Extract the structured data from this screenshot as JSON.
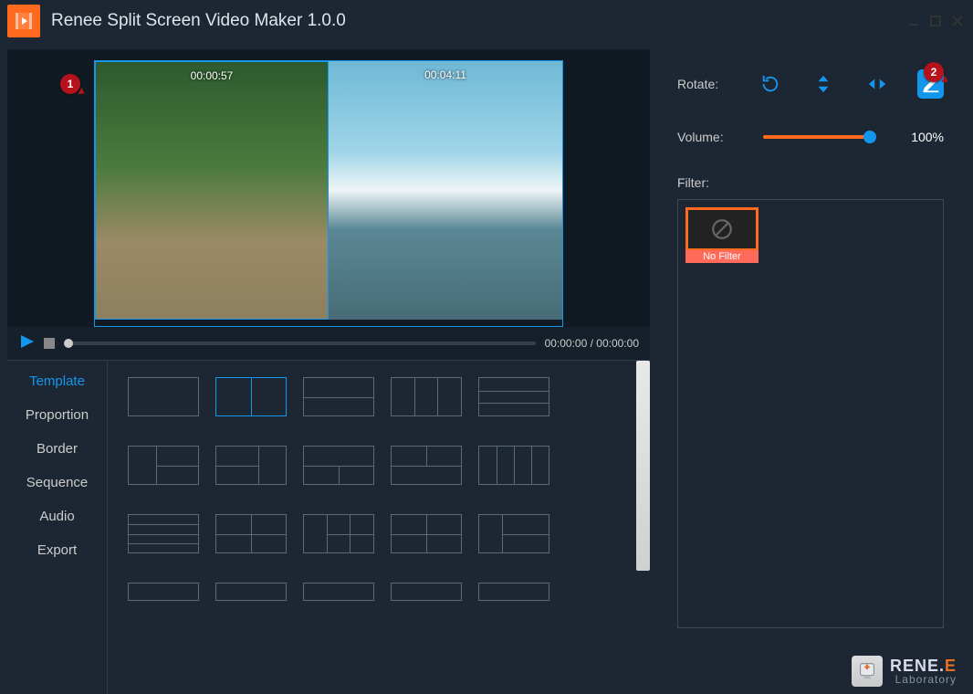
{
  "app_title": "Renee Split Screen Video Maker 1.0.0",
  "preview": {
    "pane1_time": "00:00:57",
    "pane2_time": "00:04:11"
  },
  "playback": {
    "time_counter": "00:00:00 / 00:00:00"
  },
  "tabs": [
    "Template",
    "Proportion",
    "Border",
    "Sequence",
    "Audio",
    "Export"
  ],
  "rotate_label": "Rotate:",
  "volume": {
    "label": "Volume:",
    "value_text": "100%"
  },
  "filter": {
    "label": "Filter:",
    "items": [
      {
        "name": "No Filter"
      }
    ]
  },
  "callouts": {
    "one": "1",
    "two": "2"
  },
  "brand": {
    "name_html_1": "RENE.",
    "name_html_2": "E",
    "sub": "Laboratory"
  }
}
